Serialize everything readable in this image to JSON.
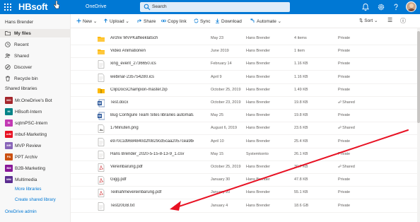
{
  "suitebar": {
    "brand": "HBsoft",
    "app_name": "OneDrive",
    "search_placeholder": "Search"
  },
  "sidebar": {
    "user_name": "Hans Brender",
    "nav": [
      {
        "label": "My files",
        "icon": "folder-icon",
        "selected": true
      },
      {
        "label": "Recent",
        "icon": "clock-icon"
      },
      {
        "label": "Shared",
        "icon": "people-icon"
      },
      {
        "label": "Discover",
        "icon": "compass-icon"
      },
      {
        "label": "Recycle bin",
        "icon": "recycle-bin-icon"
      }
    ],
    "libraries_heading": "Shared libraries",
    "libraries": [
      {
        "badge": "MO",
        "label": "Mr.OneDrive's Bot",
        "color": "#a4262c"
      },
      {
        "badge": "HI",
        "label": "HBsoft-Intern",
        "color": "#038387"
      },
      {
        "badge": "SI",
        "label": "sqtmPSC-Intern",
        "color": "#c239b3"
      },
      {
        "badge": "mM",
        "label": "mbuf-Marketing",
        "color": "#e81123"
      },
      {
        "badge": "MR",
        "label": "MVP Review",
        "color": "#8764b8"
      },
      {
        "badge": "PA",
        "label": "PPT Archiv",
        "color": "#ca5010"
      },
      {
        "badge": "BM",
        "label": "B2B-Marketing",
        "color": "#881798"
      },
      {
        "badge": "MM",
        "label": "Multimedia",
        "color": "#5c2e91"
      }
    ],
    "more_libraries": "More libraries",
    "create_library": "Create shared library",
    "admin_link": "OneDrive admin"
  },
  "commands": {
    "new": "New",
    "upload": "Upload",
    "share": "Share",
    "copy_link": "Copy link",
    "sync": "Sync",
    "download": "Download",
    "automate": "Automate",
    "sort": "Sort"
  },
  "files": [
    {
      "type": "folder",
      "name": "Archiv MVPKaffeeklatsch",
      "date": "May 23",
      "by": "Hans Brender",
      "size": "4 items",
      "sharing": "Private",
      "shared": false
    },
    {
      "type": "folder",
      "name": "Video Animationen",
      "date": "June 2019",
      "by": "Hans Brender",
      "size": "1 item",
      "sharing": "Private",
      "shared": false
    },
    {
      "type": "ics",
      "name": "xing_event_2736650.ics",
      "date": "February 14",
      "by": "Hans Brender",
      "size": "1.16 KB",
      "sharing": "Private",
      "shared": false
    },
    {
      "type": "ics",
      "name": "webinar-235754280.ics",
      "date": "April 9",
      "by": "Hans Brender",
      "size": "1.16 KB",
      "sharing": "Private",
      "shared": false
    },
    {
      "type": "zip",
      "name": "ClipDocsChampion-master.zip",
      "date": "October 25, 2019",
      "by": "Hans Brender",
      "size": "1.49 KB",
      "sharing": "Private",
      "shared": false
    },
    {
      "type": "docx",
      "name": "Test.docx",
      "date": "October 23, 2019",
      "by": "Hans Brender",
      "size": "19.8 KB",
      "sharing": "Shared",
      "shared": true
    },
    {
      "type": "docx",
      "name": "Bug Configure Team Sites libraries automati...",
      "date": "May 25",
      "by": "Hans Brender",
      "size": "19.8 KB",
      "sharing": "Private",
      "shared": false
    },
    {
      "type": "png",
      "name": "17Minuten.png",
      "date": "August 6, 2019",
      "by": "Hans Brender",
      "size": "23.6 KB",
      "sharing": "Shared",
      "shared": true
    },
    {
      "type": "file",
      "name": "e970c1d9684840d2f0829cd5caa2057cea9bc...",
      "date": "April 10",
      "by": "Hans Brender",
      "size": "25.4 KB",
      "sharing": "Private",
      "shared": false
    },
    {
      "type": "csv",
      "name": "Hans Brender_2020-5-15-8-13-9_1.csv",
      "date": "May 15",
      "by": "Systemkonto",
      "size": "26.1 KB",
      "sharing": "Private",
      "shared": false
    },
    {
      "type": "pdf",
      "name": "Vereinbarung.pdf",
      "date": "October 25, 2019",
      "by": "Hans Brender",
      "size": "30.7 KB",
      "sharing": "Shared",
      "shared": true
    },
    {
      "type": "pdf",
      "name": "Gigg.pdf",
      "date": "January 30",
      "by": "Hans Brender",
      "size": "47.8 KB",
      "sharing": "Private",
      "shared": false
    },
    {
      "type": "pdf",
      "name": "Teilnahmevereinbarung.pdf",
      "date": "January 20",
      "by": "Hans Brender",
      "size": "55.1 KB",
      "sharing": "Private",
      "shared": false
    },
    {
      "type": "txt",
      "name": "Test20GB.txt",
      "date": "January 4",
      "by": "Hans Brender",
      "size": "18.6 GB",
      "sharing": "Private",
      "shared": false
    }
  ],
  "colors": {
    "accent": "#0078d4",
    "arrow": "#e81123",
    "folder": "#ffb900",
    "word": "#2b579a",
    "pdf": "#d13438"
  }
}
